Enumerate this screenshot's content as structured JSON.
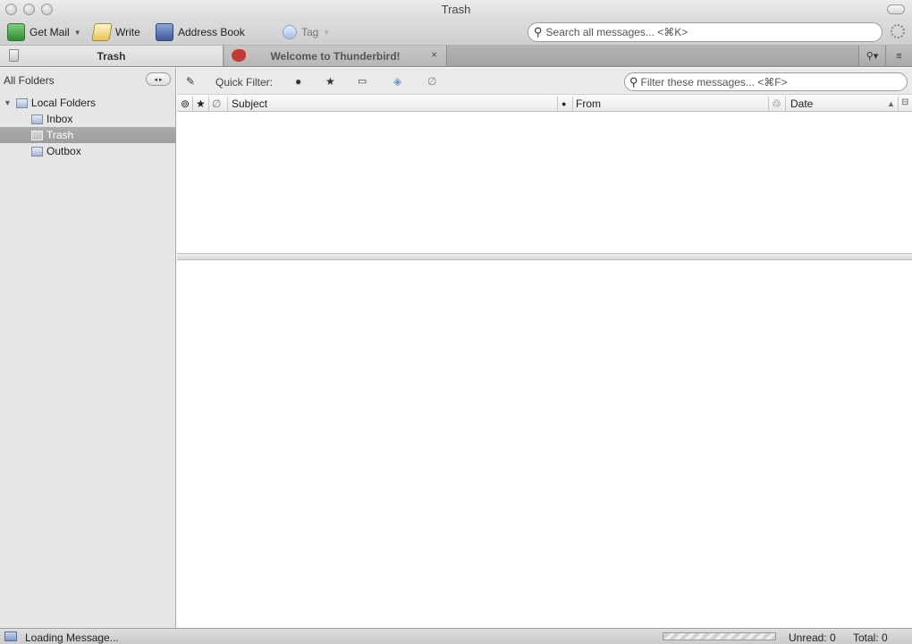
{
  "window": {
    "title": "Trash"
  },
  "toolbar": {
    "get_mail": "Get Mail",
    "write": "Write",
    "address_book": "Address Book",
    "tag": "Tag",
    "search_placeholder": "Search all messages... <⌘K>"
  },
  "tabs": [
    {
      "label": "Trash",
      "active": true,
      "icon": "trash-icon"
    },
    {
      "label": "Welcome to Thunderbird!",
      "active": false,
      "icon": "thunderbird-icon",
      "close": "×"
    }
  ],
  "sidebar": {
    "header": "All Folders",
    "nav_arrows": "◂ ▸",
    "folders": [
      {
        "label": "Local Folders",
        "icon": "computer-icon",
        "expanded": true
      },
      {
        "label": "Inbox",
        "icon": "inbox-icon"
      },
      {
        "label": "Trash",
        "icon": "trash-icon",
        "selected": true
      },
      {
        "label": "Outbox",
        "icon": "outbox-icon"
      }
    ]
  },
  "quick_filter": {
    "label": "Quick Filter:",
    "filter_placeholder": "Filter these messages... <⌘F>",
    "buttons": [
      "sticky-pin-icon",
      "unread-dot-icon",
      "star-icon",
      "contact-icon",
      "tag-icon",
      "attachment-icon"
    ]
  },
  "columns": {
    "subject": "Subject",
    "from": "From",
    "date": "Date"
  },
  "status": {
    "text": "Loading Message...",
    "unread": "Unread: 0",
    "total": "Total: 0"
  },
  "colors": {
    "selected_folder_bg": "#a5a5a5",
    "accent": "#3b6e3b"
  }
}
